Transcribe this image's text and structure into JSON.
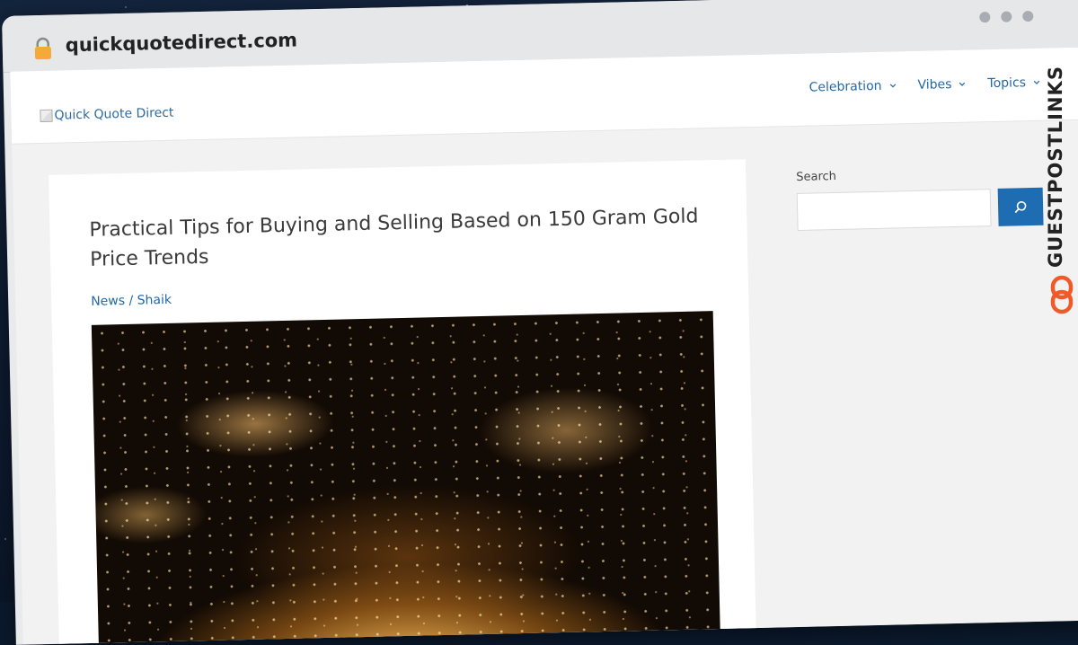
{
  "browser": {
    "url": "quickquotedirect.com"
  },
  "site": {
    "logo_alt": "Quick Quote Direct",
    "nav": [
      {
        "label": "Celebration"
      },
      {
        "label": "Vibes"
      },
      {
        "label": "Topics"
      }
    ]
  },
  "article": {
    "title": "Practical Tips for Buying and Selling Based on 150 Gram Gold Price Trends",
    "category": "News",
    "separator": " / ",
    "author": "Shaik"
  },
  "sidebar": {
    "search_label": "Search",
    "search_value": ""
  },
  "watermark": {
    "text": "GUESTPOSTLINKS",
    "accent_color": "#f05a28"
  },
  "colors": {
    "link": "#1f67a8",
    "search_button": "#1e6db3",
    "lock": "#f4a938"
  }
}
